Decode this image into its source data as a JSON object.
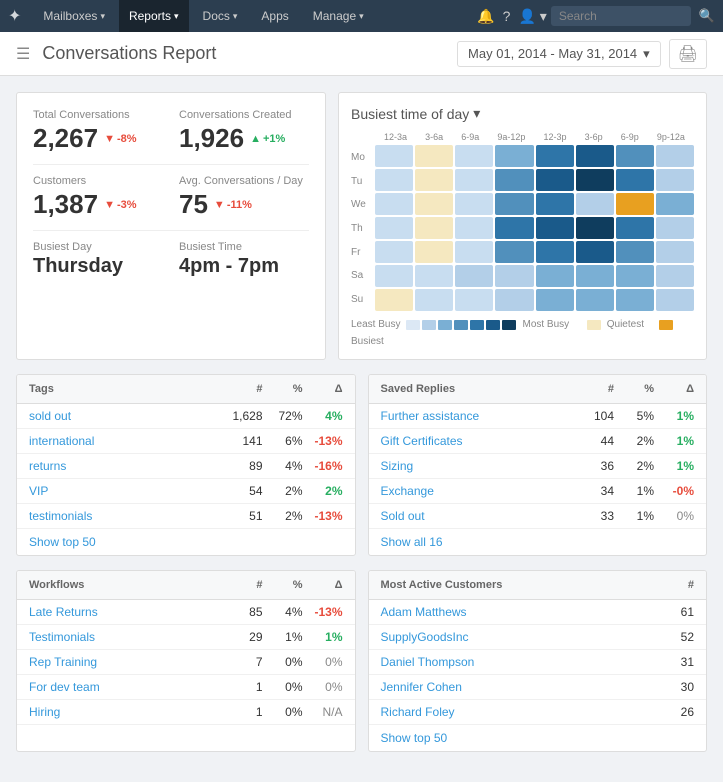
{
  "nav": {
    "logo": "✦",
    "items": [
      {
        "label": "Mailboxes",
        "chevron": true,
        "active": false
      },
      {
        "label": "Reports",
        "chevron": true,
        "active": true
      },
      {
        "label": "Docs",
        "chevron": true,
        "active": false
      },
      {
        "label": "Apps",
        "chevron": false,
        "active": false
      },
      {
        "label": "Manage",
        "chevron": true,
        "active": false
      }
    ],
    "search_placeholder": "Search"
  },
  "page": {
    "title": "Conversations Report",
    "date_range": "May 01, 2014 - May 31, 2014",
    "print_icon": "🖨"
  },
  "stats": {
    "total_conversations_label": "Total Conversations",
    "total_conversations_value": "2,267",
    "total_conversations_delta": "-8%",
    "conversations_created_label": "Conversations Created",
    "conversations_created_value": "1,926",
    "conversations_created_delta": "+1%",
    "customers_label": "Customers",
    "customers_value": "1,387",
    "customers_delta": "-3%",
    "avg_convos_label": "Avg. Conversations / Day",
    "avg_convos_value": "75",
    "avg_convos_delta": "-11%",
    "busiest_day_label": "Busiest Day",
    "busiest_day_value": "Thursday",
    "busiest_time_label": "Busiest Time",
    "busiest_time_value": "4pm - 7pm"
  },
  "heatmap": {
    "title": "Busiest time of day",
    "col_labels": [
      "12-3a",
      "3-6a",
      "6-9a",
      "9a-12p",
      "12-3p",
      "3-6p",
      "6-9p",
      "9p-12a"
    ],
    "row_labels": [
      "Mo",
      "Tu",
      "We",
      "Th",
      "Fr",
      "Sa",
      "Su"
    ],
    "legend_least": "Least Busy",
    "legend_most": "Most Busy",
    "legend_quietest": "Quietest",
    "legend_busiest": "Busiest",
    "cells": [
      [
        1,
        0,
        1,
        3,
        5,
        6,
        4,
        2
      ],
      [
        1,
        0,
        1,
        4,
        6,
        7,
        5,
        2
      ],
      [
        1,
        0,
        1,
        4,
        5,
        2,
        8,
        3
      ],
      [
        1,
        0,
        1,
        5,
        6,
        7,
        5,
        2
      ],
      [
        1,
        0,
        1,
        4,
        5,
        6,
        4,
        2
      ],
      [
        1,
        1,
        2,
        2,
        3,
        3,
        3,
        2
      ],
      [
        0,
        1,
        1,
        2,
        3,
        3,
        3,
        2
      ]
    ]
  },
  "tags": {
    "title": "Tags",
    "col_hash": "#",
    "col_pct": "%",
    "col_delta": "Δ",
    "rows": [
      {
        "name": "sold out",
        "hash": "1,628",
        "pct": "72%",
        "delta": "4%",
        "delta_type": "pos"
      },
      {
        "name": "international",
        "hash": "141",
        "pct": "6%",
        "delta": "-13%",
        "delta_type": "neg"
      },
      {
        "name": "returns",
        "hash": "89",
        "pct": "4%",
        "delta": "-16%",
        "delta_type": "neg"
      },
      {
        "name": "VIP",
        "hash": "54",
        "pct": "2%",
        "delta": "2%",
        "delta_type": "pos"
      },
      {
        "name": "testimonials",
        "hash": "51",
        "pct": "2%",
        "delta": "-13%",
        "delta_type": "neg"
      }
    ],
    "show_more": "Show top 50"
  },
  "saved_replies": {
    "title": "Saved Replies",
    "col_hash": "#",
    "col_pct": "%",
    "col_delta": "Δ",
    "rows": [
      {
        "name": "Further assistance",
        "hash": "104",
        "pct": "5%",
        "delta": "1%",
        "delta_type": "pos"
      },
      {
        "name": "Gift Certificates",
        "hash": "44",
        "pct": "2%",
        "delta": "1%",
        "delta_type": "pos"
      },
      {
        "name": "Sizing",
        "hash": "36",
        "pct": "2%",
        "delta": "1%",
        "delta_type": "pos"
      },
      {
        "name": "Exchange",
        "hash": "34",
        "pct": "1%",
        "delta": "-0%",
        "delta_type": "neg"
      },
      {
        "name": "Sold out",
        "hash": "33",
        "pct": "1%",
        "delta": "0%",
        "delta_type": "zero"
      }
    ],
    "show_more": "Show all 16"
  },
  "workflows": {
    "title": "Workflows",
    "col_hash": "#",
    "col_pct": "%",
    "col_delta": "Δ",
    "rows": [
      {
        "name": "Late Returns",
        "hash": "85",
        "pct": "4%",
        "delta": "-13%",
        "delta_type": "neg"
      },
      {
        "name": "Testimonials",
        "hash": "29",
        "pct": "1%",
        "delta": "1%",
        "delta_type": "pos"
      },
      {
        "name": "Rep Training",
        "hash": "7",
        "pct": "0%",
        "delta": "0%",
        "delta_type": "zero"
      },
      {
        "name": "For dev team",
        "hash": "1",
        "pct": "0%",
        "delta": "0%",
        "delta_type": "zero"
      },
      {
        "name": "Hiring",
        "hash": "1",
        "pct": "0%",
        "delta": "N/A",
        "delta_type": "na"
      }
    ]
  },
  "customers": {
    "title": "Most Active Customers",
    "col_hash": "#",
    "rows": [
      {
        "name": "Adam Matthews",
        "hash": "61"
      },
      {
        "name": "SupplyGoodsInc",
        "hash": "52"
      },
      {
        "name": "Daniel Thompson",
        "hash": "31"
      },
      {
        "name": "Jennifer Cohen",
        "hash": "30"
      },
      {
        "name": "Richard Foley",
        "hash": "26"
      }
    ],
    "show_more": "Show top 50"
  },
  "colors": {
    "brand": "#3498db",
    "nav_bg": "#2c3e50",
    "heatmap_0": "#dce8f5",
    "heatmap_1": "#b3cfe8",
    "heatmap_2": "#7aafd4",
    "heatmap_3": "#5190bc",
    "heatmap_4": "#2e75a8",
    "heatmap_5": "#1a5a8a",
    "heatmap_6": "#0f3d5e",
    "heatmap_7": "#081e30",
    "heatmap_8": "#e8a020",
    "heatmap_quietest": "#f5e8c0"
  }
}
